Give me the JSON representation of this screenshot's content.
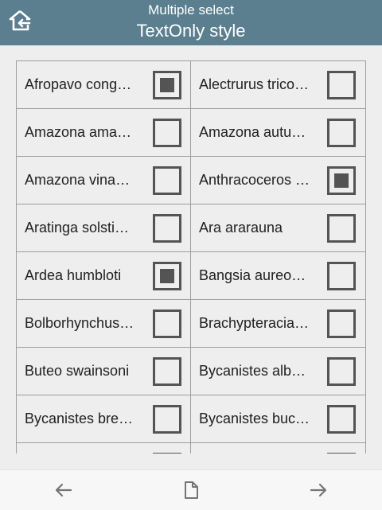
{
  "header": {
    "subtitle": "Multiple select",
    "title": "TextOnly style",
    "home_icon": "home-back-icon"
  },
  "items": [
    {
      "label": "Afropavo cong…",
      "checked": true
    },
    {
      "label": "Alectrurus trico…",
      "checked": false
    },
    {
      "label": "Amazona ama…",
      "checked": false
    },
    {
      "label": "Amazona autu…",
      "checked": false
    },
    {
      "label": "Amazona vina…",
      "checked": false
    },
    {
      "label": "Anthracoceros …",
      "checked": true
    },
    {
      "label": "Aratinga solsti…",
      "checked": false
    },
    {
      "label": "Ara ararauna",
      "checked": false
    },
    {
      "label": "Ardea humbloti",
      "checked": true
    },
    {
      "label": "Bangsia aureo…",
      "checked": false
    },
    {
      "label": "Bolborhynchus…",
      "checked": false
    },
    {
      "label": "Brachypteracia…",
      "checked": false
    },
    {
      "label": "Buteo swainsoni",
      "checked": false
    },
    {
      "label": "Bycanistes alb…",
      "checked": false
    },
    {
      "label": "Bycanistes bre…",
      "checked": false
    },
    {
      "label": "Bycanistes buc…",
      "checked": false
    },
    {
      "label": "",
      "checked": false
    },
    {
      "label": "",
      "checked": false
    }
  ],
  "footer": {
    "prev_icon": "arrow-left-icon",
    "page_icon": "document-icon",
    "next_icon": "arrow-right-icon"
  },
  "colors": {
    "header_bg": "#5c7f90",
    "checkbox": "#545454",
    "background": "#eeeeee"
  }
}
